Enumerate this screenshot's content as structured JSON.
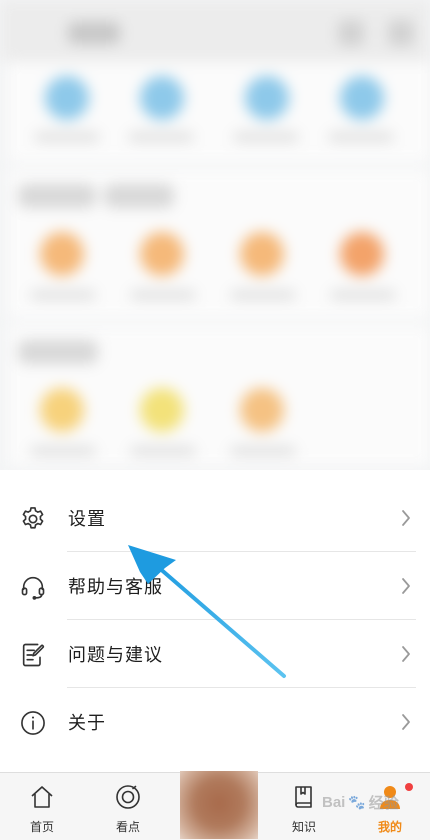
{
  "menu": {
    "items": [
      {
        "label": "设置",
        "icon": "gear-icon"
      },
      {
        "label": "帮助与客服",
        "icon": "headset-icon"
      },
      {
        "label": "问题与建议",
        "icon": "feedback-edit-icon"
      },
      {
        "label": "关于",
        "icon": "info-icon"
      }
    ]
  },
  "tabbar": {
    "tabs": [
      {
        "label": "首页",
        "icon": "home-icon"
      },
      {
        "label": "看点",
        "icon": "explore-icon"
      },
      {
        "label": "",
        "icon": "avatar"
      },
      {
        "label": "知识",
        "icon": "book-icon"
      },
      {
        "label": "我的",
        "icon": "profile-icon",
        "active": true
      }
    ],
    "active_color": "#f08a18",
    "badge_color": "#f04040"
  },
  "watermark": {
    "text": "Bai",
    "suffix": "经验"
  },
  "annotation": {
    "arrow_color": "#2ba3e0",
    "target": "设置"
  }
}
